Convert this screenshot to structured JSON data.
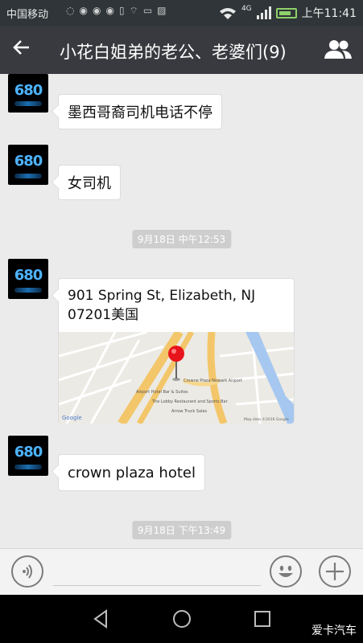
{
  "status_bar": {
    "carrier": "中国移动",
    "network": "4G",
    "time": "上午11:41"
  },
  "header": {
    "title": "小花白姐弟的老公、老婆们(9)"
  },
  "avatar": {
    "text": "680"
  },
  "messages": [
    {
      "type": "text",
      "text": "墨西哥裔司机电话不停"
    },
    {
      "type": "text",
      "text": "女司机"
    },
    {
      "type": "time",
      "text": "9月18日 中午12:53"
    },
    {
      "type": "location",
      "address_line1": "901 Spring St, Elizabeth, NJ",
      "address_line2": "07201美国"
    },
    {
      "type": "text",
      "text": "crown plaza hotel"
    },
    {
      "type": "time",
      "text": "9月18日 下午13:49"
    }
  ],
  "map": {
    "labels": [
      "Crowne Plaza Newark Airport",
      "Airport Hotel Bar & Suites",
      "The Lobby Restaurant and Sports Bar",
      "Arrow Truck Sales"
    ],
    "provider": "Google",
    "attribution": "Map data ©2016 Google"
  },
  "watermark": "爱卡汽车",
  "colors": {
    "title_bar": "#393a3f",
    "status_bar": "#2f3538",
    "chat_bg": "#ebebeb",
    "pin": "#e8141b"
  }
}
